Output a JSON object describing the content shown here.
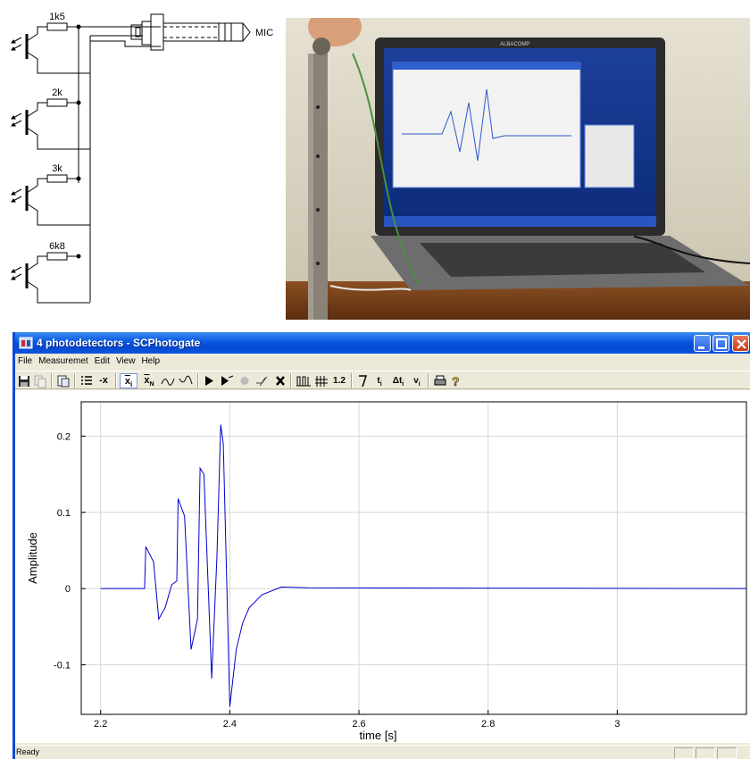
{
  "schematic": {
    "resistors": [
      "1k5",
      "2k",
      "3k",
      "6k8"
    ],
    "connector_label": "MIC"
  },
  "photo": {
    "laptop_brand": "ALBACOMP"
  },
  "window": {
    "title": "4 photodetectors - SCPhotogate",
    "menu": [
      "File",
      "Measuremet",
      "Edit",
      "View",
      "Help"
    ],
    "toolbar": {
      "x_i": "x",
      "x_n": "x",
      "number": "1.2",
      "t_i": "t",
      "dt_i": "Δt",
      "v_i": "v",
      "sub_i": "i",
      "sub_n": "N"
    },
    "status": "Ready"
  },
  "chart_data": {
    "type": "line",
    "title": "",
    "xlabel": "time [s]",
    "ylabel": "Amplitude",
    "xlim": [
      2.17,
      3.2
    ],
    "ylim": [
      -0.165,
      0.245
    ],
    "xticks": [
      2.2,
      2.4,
      2.6,
      2.8,
      3
    ],
    "xtick_labels": [
      "2.2",
      "2.4",
      "2.6",
      "2.8",
      "3"
    ],
    "yticks": [
      -0.1,
      0,
      0.1,
      0.2
    ],
    "ytick_labels": [
      "-0.1",
      "0",
      "0.1",
      "0.2"
    ],
    "grid": true,
    "series": [
      {
        "color": "#0000cc",
        "x": [
          2.2,
          2.268,
          2.27,
          2.282,
          2.29,
          2.3,
          2.31,
          2.318,
          2.32,
          2.33,
          2.34,
          2.35,
          2.354,
          2.36,
          2.372,
          2.38,
          2.386,
          2.39,
          2.4,
          2.41,
          2.42,
          2.43,
          2.45,
          2.48,
          2.52,
          3.2
        ],
        "y": [
          0,
          0,
          0.055,
          0.035,
          -0.04,
          -0.025,
          0.005,
          0.01,
          0.118,
          0.095,
          -0.08,
          -0.04,
          0.158,
          0.15,
          -0.118,
          0.04,
          0.215,
          0.19,
          -0.155,
          -0.08,
          -0.045,
          -0.025,
          -0.008,
          0.002,
          0.001,
          0
        ]
      }
    ]
  }
}
